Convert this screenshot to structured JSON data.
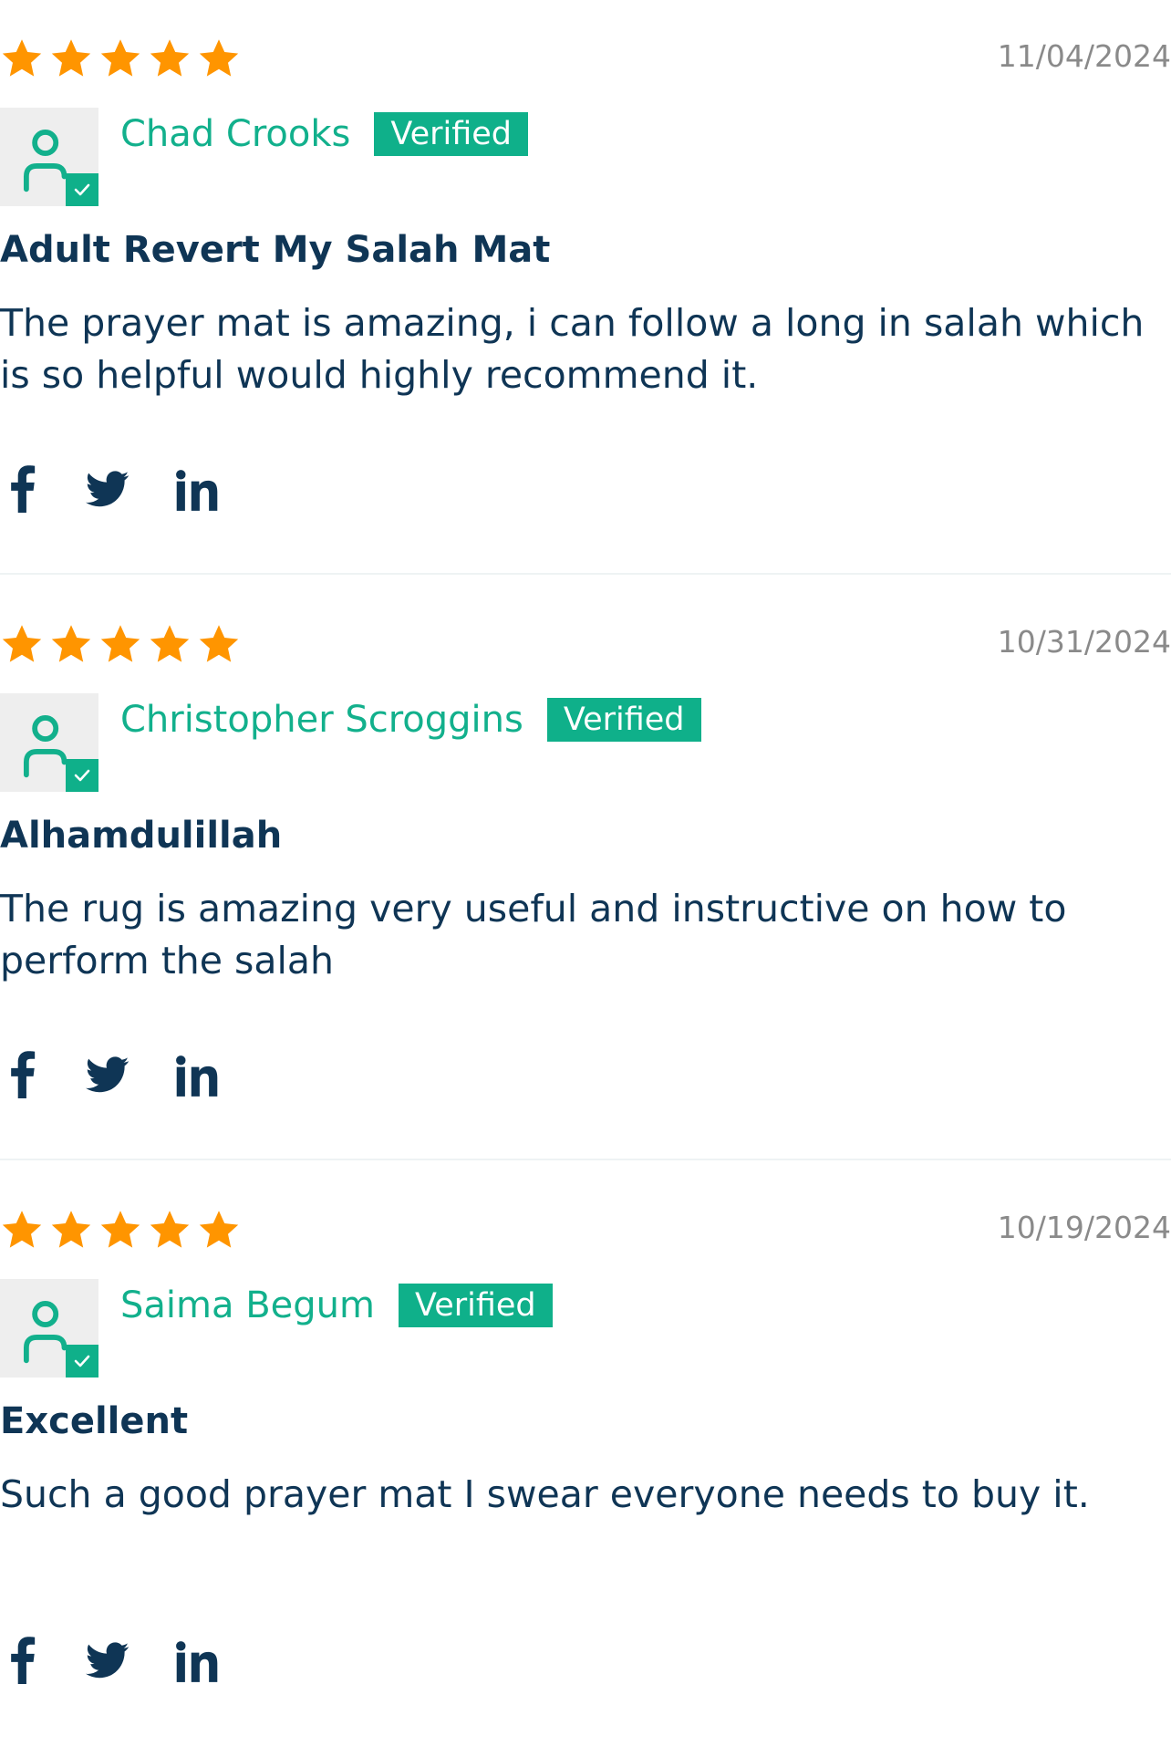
{
  "colors": {
    "star": "#ff9500",
    "accent_green": "#12b08c",
    "verified_badge": "#0fb08a",
    "text_dark": "#0f3555",
    "date_gray": "#8a8a8a",
    "avatar_bg": "#eeeeee"
  },
  "icons": [
    "star-icon",
    "user-avatar-icon",
    "checkmark-icon",
    "facebook-icon",
    "twitter-icon",
    "linkedin-icon"
  ],
  "reviews": [
    {
      "rating": 5,
      "date": "11/04/2024",
      "author": "Chad Crooks",
      "badge": "Verified",
      "title": "Adult Revert My Salah Mat",
      "body": "The prayer mat is amazing, i can follow a long in salah which is so helpful would highly recommend it."
    },
    {
      "rating": 5,
      "date": "10/31/2024",
      "author": "Christopher Scroggins",
      "badge": "Verified",
      "title": "Alhamdulillah",
      "body": "The rug is amazing very useful and instructive on how to perform the salah"
    },
    {
      "rating": 5,
      "date": "10/19/2024",
      "author": "Saima Begum",
      "badge": "Verified",
      "title": "Excellent",
      "body": "Such a good prayer mat I swear everyone needs to buy it."
    }
  ]
}
